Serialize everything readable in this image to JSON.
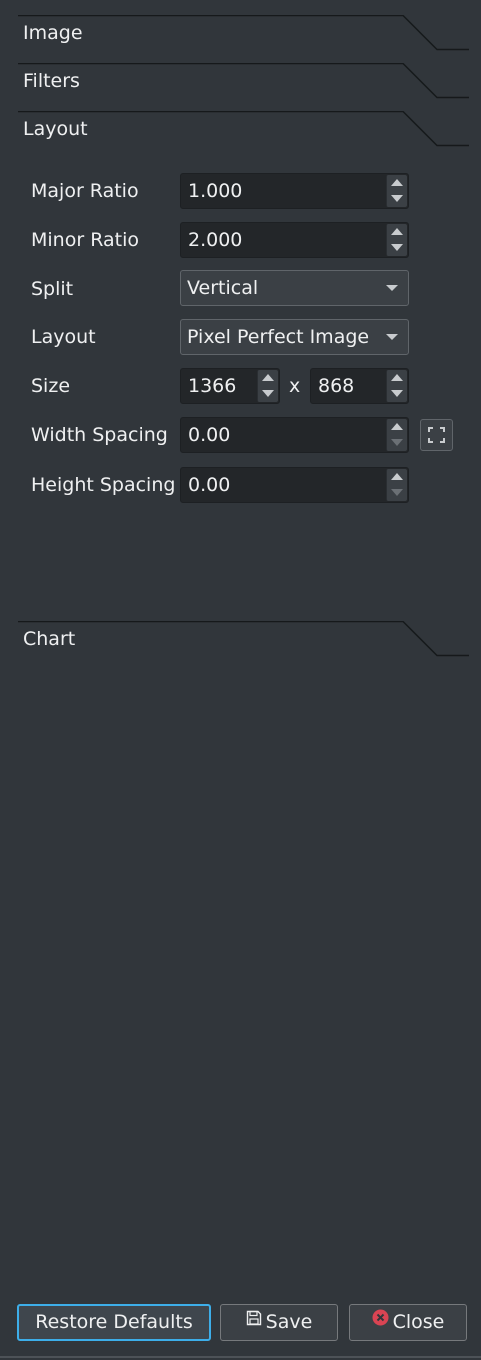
{
  "sections": {
    "image": "Image",
    "filters": "Filters",
    "layout": "Layout",
    "chart": "Chart"
  },
  "layout_form": {
    "major_ratio": {
      "label": "Major Ratio",
      "value": "1.000"
    },
    "minor_ratio": {
      "label": "Minor Ratio",
      "value": "2.000"
    },
    "split": {
      "label": "Split",
      "value": "Vertical"
    },
    "layout": {
      "label": "Layout",
      "value": "Pixel Perfect Image | "
    },
    "size": {
      "label": "Size",
      "width": "1366",
      "separator": "x",
      "height": "868"
    },
    "width_spacing": {
      "label": "Width Spacing",
      "value": "0.00"
    },
    "height_spacing": {
      "label": "Height Spacing",
      "value": "0.00"
    }
  },
  "buttons": {
    "restore": "Restore Defaults",
    "save": "Save",
    "close": "Close"
  },
  "colors": {
    "background": "#31363b",
    "field": "#232629",
    "accent": "#3daee9",
    "close_icon": "#da4453"
  },
  "icons": {
    "save": "floppy-disk-icon",
    "close": "close-circle-icon",
    "fit": "fullscreen-icon"
  }
}
